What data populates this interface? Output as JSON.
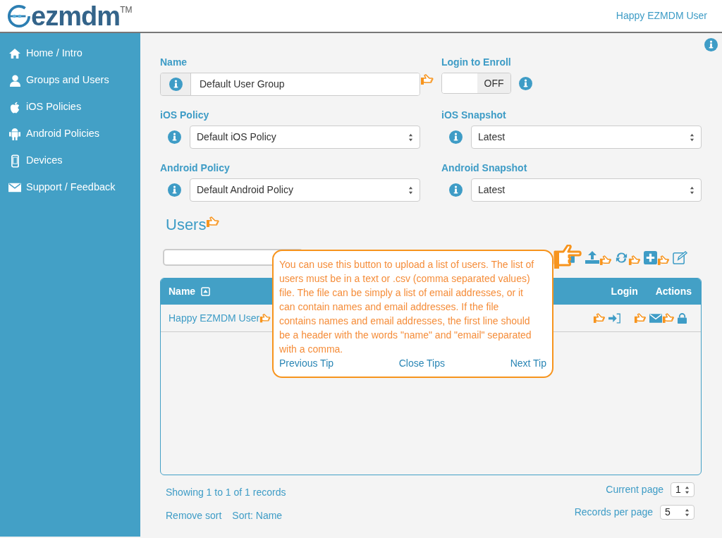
{
  "header": {
    "logo": "ezmdm",
    "trademark": "TM",
    "user": "Happy EZMDM User"
  },
  "sidebar": {
    "items": [
      {
        "label": "Home / Intro"
      },
      {
        "label": "Groups and Users"
      },
      {
        "label": "iOS Policies"
      },
      {
        "label": "Android Policies"
      },
      {
        "label": "Devices"
      },
      {
        "label": "Support / Feedback"
      }
    ]
  },
  "form": {
    "name": {
      "label": "Name",
      "value": "Default User Group"
    },
    "login_to_enroll": {
      "label": "Login to Enroll",
      "on": false,
      "text": "OFF"
    },
    "ios_policy": {
      "label": "iOS Policy",
      "value": "Default iOS Policy"
    },
    "ios_snapshot": {
      "label": "iOS Snapshot",
      "value": "Latest"
    },
    "android_policy": {
      "label": "Android Policy",
      "value": "Default Android Policy"
    },
    "android_snapshot": {
      "label": "Android Snapshot",
      "value": "Latest"
    }
  },
  "users": {
    "title": "Users",
    "table": {
      "columns": [
        "Name",
        "Login",
        "Actions"
      ],
      "rows": [
        {
          "name": "Happy EZMDM User"
        }
      ]
    },
    "footer": {
      "showing": "Showing 1 to 1 of 1 records",
      "remove_sort": "Remove sort",
      "sort": "Sort: Name",
      "current_page_label": "Current page",
      "current_page": "1",
      "per_page_label": "Records per page",
      "per_page": "5"
    }
  },
  "tip": {
    "text": "You can use this button to upload a list of users. The list of users must be in a text or .csv (comma separated values) file. The file can be simply a list of email addresses, or it can contain names and email addresses. If the file contains names and email addresses, the first line should be a header with the words \"name\" and \"email\" separated with a comma.",
    "buttons": [
      "Previous Tip",
      "Close Tips",
      "Next Tip"
    ]
  }
}
